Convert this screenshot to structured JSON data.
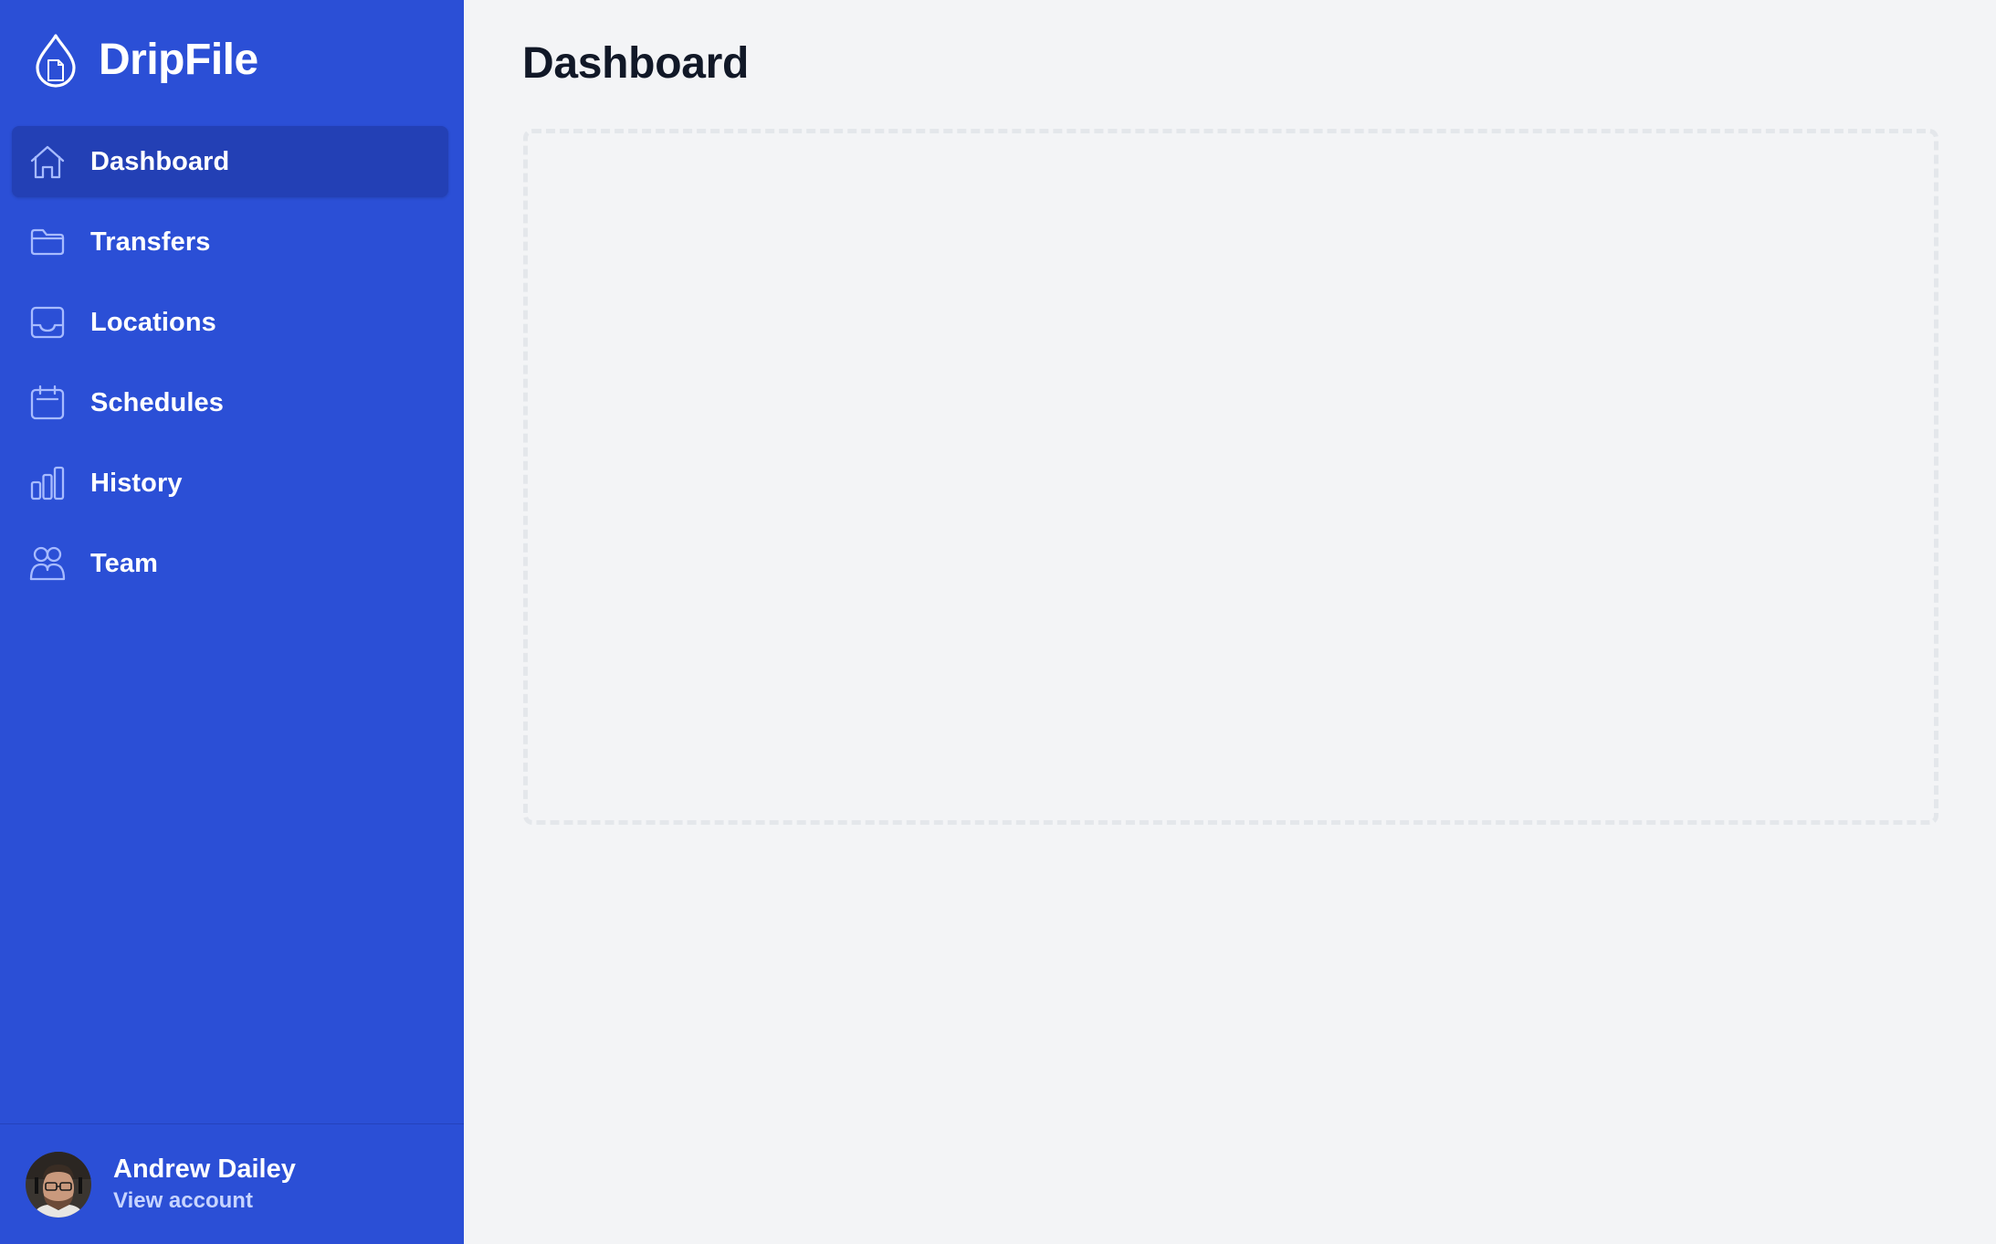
{
  "brand": {
    "name": "DripFile",
    "logo_icon": "drop-file-icon"
  },
  "sidebar": {
    "items": [
      {
        "label": "Dashboard",
        "icon": "home-icon",
        "active": true
      },
      {
        "label": "Transfers",
        "icon": "folder-icon",
        "active": false
      },
      {
        "label": "Locations",
        "icon": "inbox-icon",
        "active": false
      },
      {
        "label": "Schedules",
        "icon": "calendar-icon",
        "active": false
      },
      {
        "label": "History",
        "icon": "bar-chart-icon",
        "active": false
      },
      {
        "label": "Team",
        "icon": "users-icon",
        "active": false
      }
    ]
  },
  "account": {
    "name": "Andrew Dailey",
    "link_label": "View account"
  },
  "main": {
    "title": "Dashboard"
  },
  "colors": {
    "sidebar_bg": "#2b4fd6",
    "active_item_bg": "#2340b5",
    "icon_stroke": "#a7bbff",
    "main_bg": "#f3f4f6",
    "placeholder_border": "#e4e7eb"
  }
}
